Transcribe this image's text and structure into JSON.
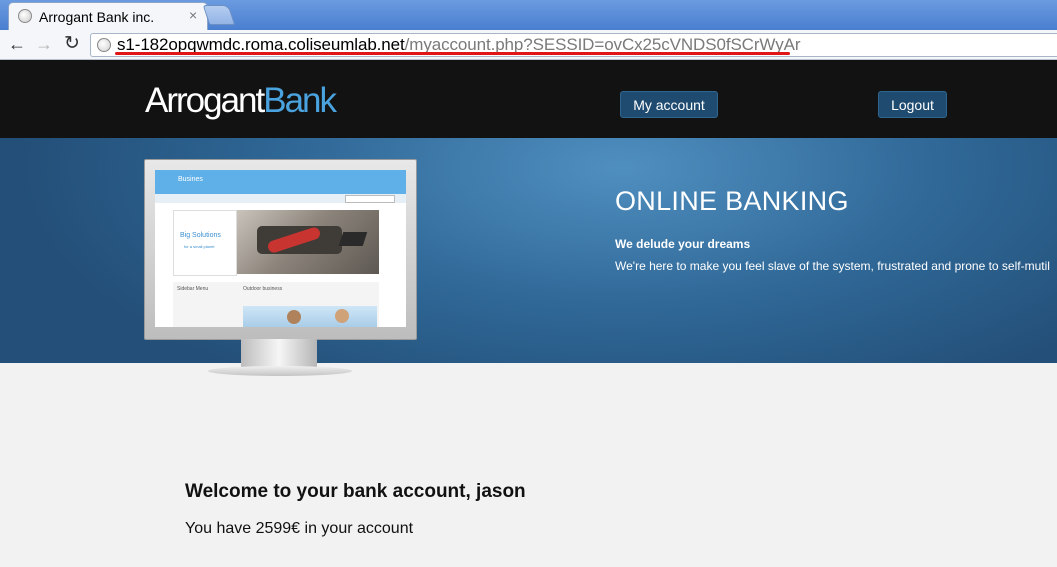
{
  "browser": {
    "tab_title": "Arrogant Bank inc.",
    "tab_close": "×",
    "url_host": "s1-182opqwmdc.roma.coliseumlab.net",
    "url_path": "/myaccount.php?SESSID=ovCx25cVNDS0fSCrWyAr",
    "back_label": "←",
    "forward_label": "→",
    "reload_label": "↻"
  },
  "header": {
    "logo_part1": "Arrogant",
    "logo_part2": "Bank",
    "logo_color_part1": "#ffffff",
    "logo_color_part2": "#4aa3df",
    "my_account_label": "My account",
    "logout_label": "Logout"
  },
  "banner": {
    "title": "ONLINE BANKING",
    "subtitle": "We delude your dreams",
    "text": "We're here to make you feel slave of the system, frustrated and prone to self-mutil",
    "screen_brand": "Busines",
    "screen_hero_title": "Big Solutions",
    "screen_hero_sub": "for a small planet",
    "screen_sidebar_title": "Sidebar Menu",
    "screen_col_title": "Outdoor business"
  },
  "main": {
    "welcome": "Welcome to your bank account, jason",
    "balance": "You have 2599€ in your account"
  },
  "colors": {
    "header_bg": "#121212",
    "button_bg": "#1f4b70",
    "banner_bg": "#2f6796",
    "url_underline": "#e01515"
  }
}
